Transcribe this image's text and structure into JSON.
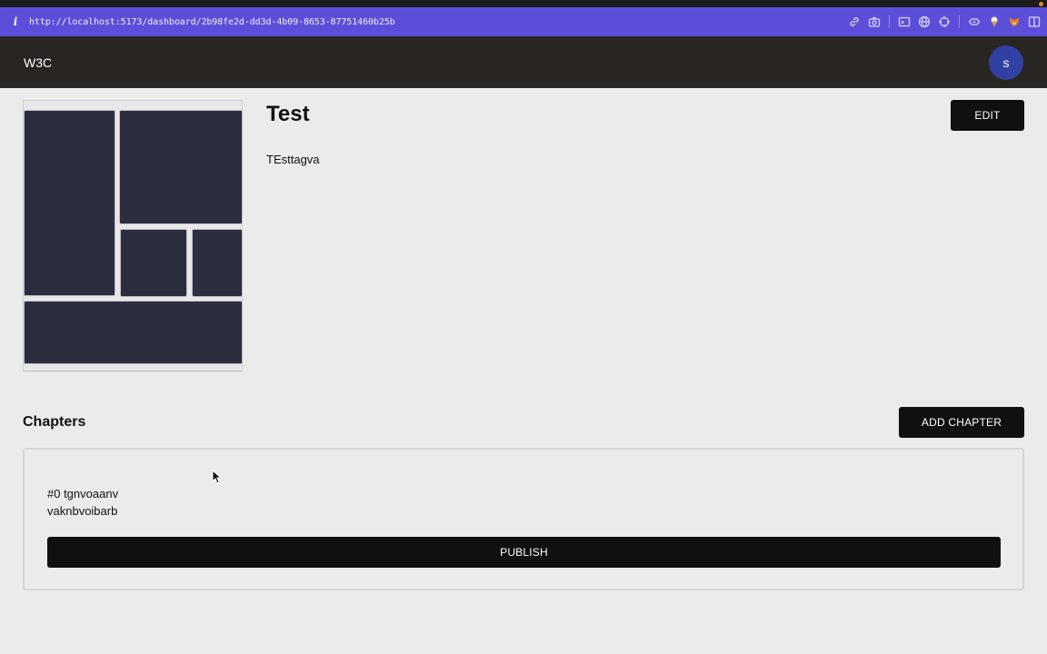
{
  "browser": {
    "info_glyph": "i",
    "url": "http://localhost:5173/dashboard/2b98fe2d-dd3d-4b09-8653-87751460b25b",
    "accent_color": "#5b4fd9",
    "tool_icons": [
      "link-icon",
      "camera-icon",
      "terminal-icon",
      "globe-icon",
      "crosshair-icon",
      "extension-icon",
      "ice-cream-icon",
      "fox-icon",
      "sidebar-icon"
    ]
  },
  "app": {
    "brand": "W3C",
    "avatar_initial": "s",
    "avatar_color": "#3140a3"
  },
  "project": {
    "title": "Test",
    "description": "TEsttagva",
    "edit_label": "EDIT"
  },
  "chapters": {
    "heading": "Chapters",
    "add_label": "ADD CHAPTER",
    "items": [
      {
        "number_title": "#0 tgnvoaanv",
        "subtitle": "vaknbvoibarb",
        "publish_label": "PUBLISH"
      }
    ]
  }
}
